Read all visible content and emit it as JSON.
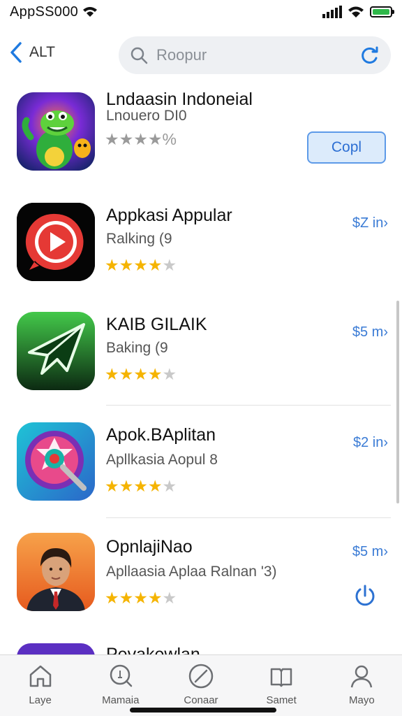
{
  "status_bar": {
    "carrier": "AppSS000"
  },
  "nav": {
    "back_label": "ALT",
    "search_placeholder": "Roopur"
  },
  "apps": [
    {
      "name": "Lndaasin Indoneial",
      "subtitle": "Lnouero DI0",
      "rating_text": "★★★★%",
      "action": "Copl",
      "rating": 0
    },
    {
      "name": "Appkasi Appular",
      "subtitle": "Ralking (9",
      "price": "$Z in›",
      "rating": 4
    },
    {
      "name": "KAIB GILAIK",
      "subtitle": "Baking (9",
      "price": "$5 m›",
      "rating": 4
    },
    {
      "name": "Apok.BAplitan",
      "subtitle": "Apllkasia Aopul  8",
      "price": "$2 in›",
      "rating": 4
    },
    {
      "name": "OpnlajiNao",
      "subtitle": "Apllaasia Aplaa Ralnan '3)",
      "price": "$5 m›",
      "rating": 4
    },
    {
      "name": "Pevakewlan",
      "subtitle": "",
      "price": "",
      "rating": 0
    }
  ],
  "tabs": [
    {
      "label": "Laye",
      "icon": "home-icon"
    },
    {
      "label": "Mamaia",
      "icon": "search-icon"
    },
    {
      "label": "Conaar",
      "icon": "compass-icon"
    },
    {
      "label": "Samet",
      "icon": "book-icon"
    },
    {
      "label": "Mayo",
      "icon": "person-icon"
    }
  ],
  "colors": {
    "accent": "#1f7ae0",
    "star": "#f5b400",
    "battery": "#2fb84a"
  }
}
